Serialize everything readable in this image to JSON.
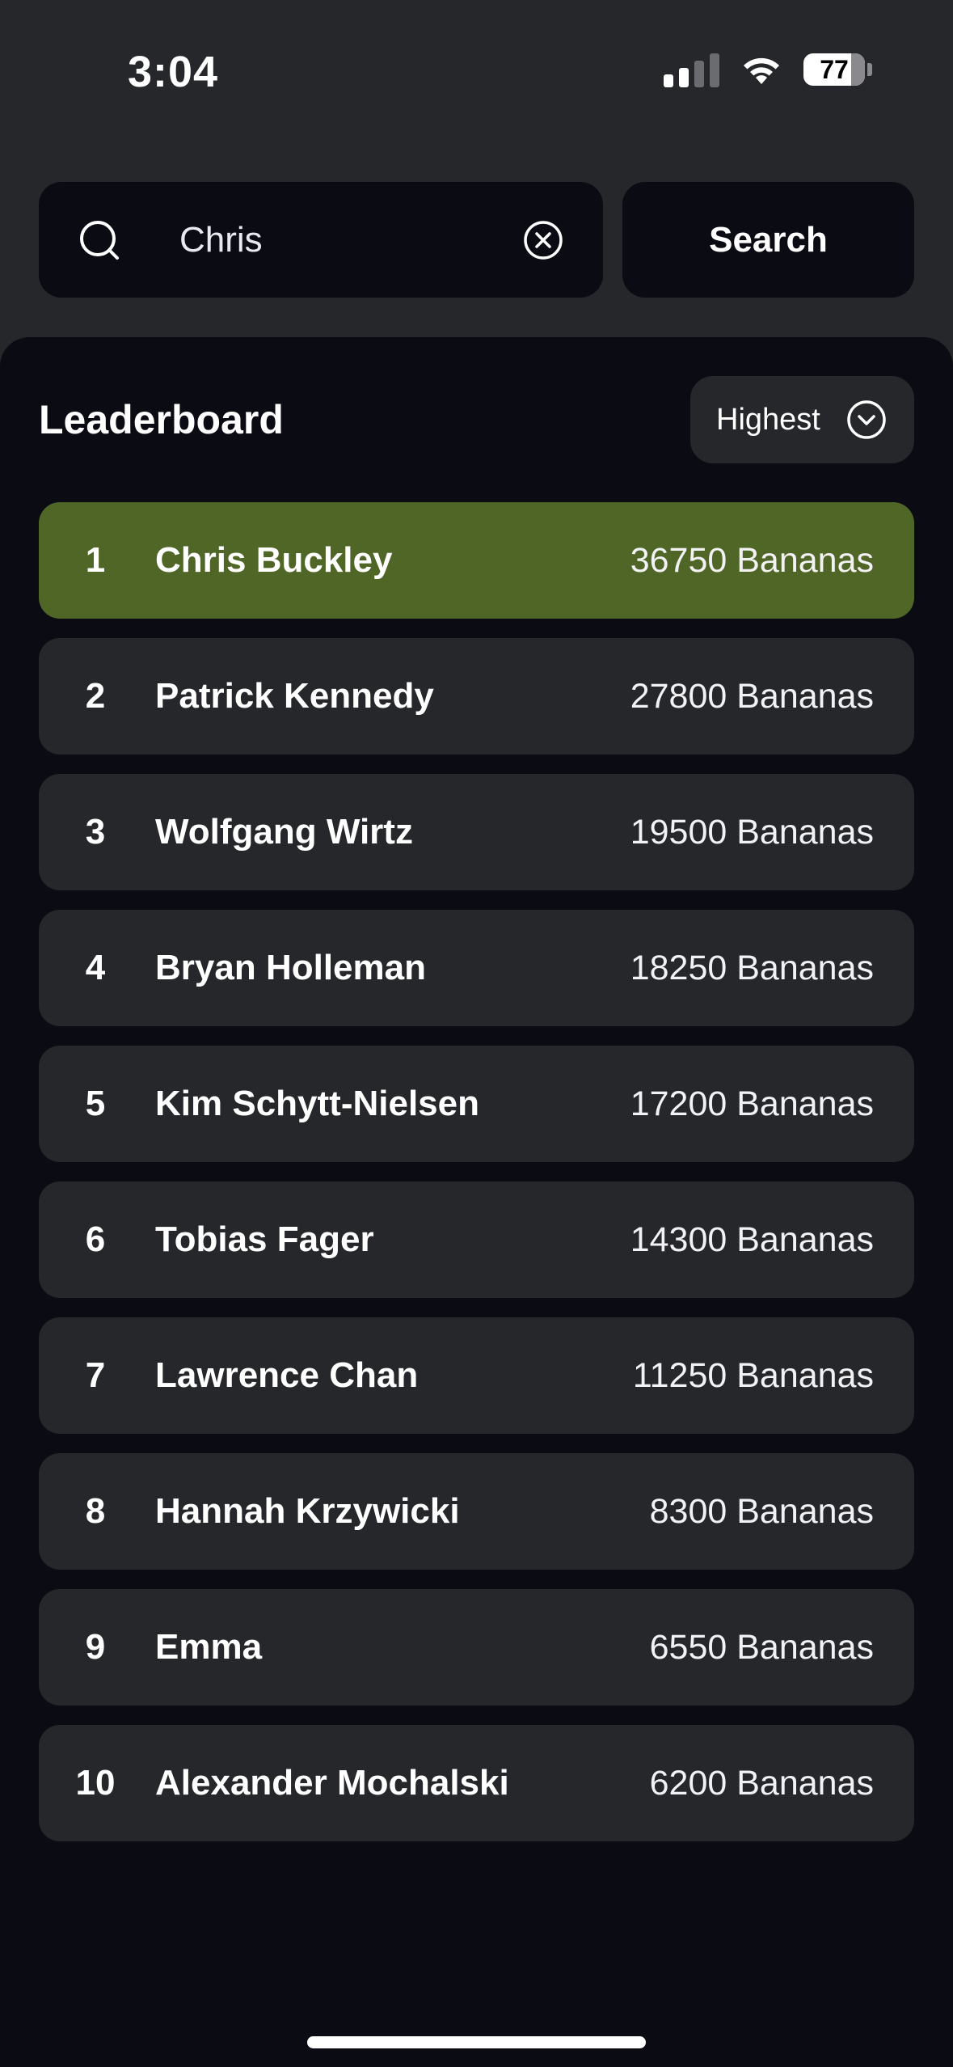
{
  "status_bar": {
    "time": "3:04",
    "battery": "77",
    "icons": [
      "cellular-signal-icon",
      "wifi-icon",
      "battery-icon"
    ]
  },
  "search": {
    "value": "Chris",
    "button_label": "Search",
    "icons": [
      "search-icon",
      "clear-icon"
    ]
  },
  "leaderboard": {
    "title": "Leaderboard",
    "sort_label": "Highest",
    "sort_icon": "chevron-down-icon",
    "highlight_color": "#506627",
    "rows": [
      {
        "rank": "1",
        "name": "Chris Buckley",
        "score": "36750 Bananas"
      },
      {
        "rank": "2",
        "name": "Patrick Kennedy",
        "score": "27800 Bananas"
      },
      {
        "rank": "3",
        "name": "Wolfgang Wirtz",
        "score": "19500 Bananas"
      },
      {
        "rank": "4",
        "name": "Bryan Holleman",
        "score": "18250 Bananas"
      },
      {
        "rank": "5",
        "name": "Kim Schytt-Nielsen",
        "score": "17200 Bananas"
      },
      {
        "rank": "6",
        "name": "Tobias Fager",
        "score": "14300 Bananas"
      },
      {
        "rank": "7",
        "name": "Lawrence Chan",
        "score": "11250 Bananas"
      },
      {
        "rank": "8",
        "name": "Hannah Krzywicki",
        "score": "8300 Bananas"
      },
      {
        "rank": "9",
        "name": "Emma",
        "score": "6550 Bananas"
      },
      {
        "rank": "10",
        "name": "Alexander Mochalski",
        "score": "6200 Bananas"
      }
    ]
  }
}
